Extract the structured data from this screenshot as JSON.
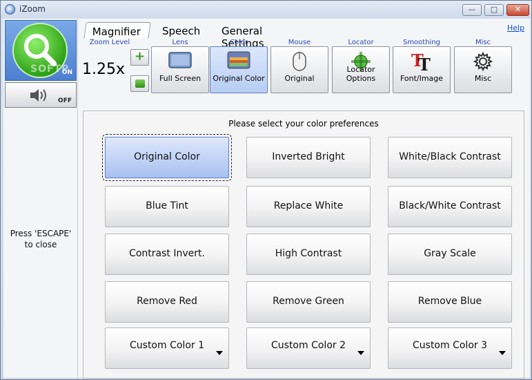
{
  "window": {
    "title": "iZoom",
    "min_glyph": "—",
    "max_glyph": "□",
    "close_glyph": "✕"
  },
  "left_panel": {
    "on_label": "ON",
    "watermark": "SOFTP",
    "off_label": "OFF",
    "escape_text": "Press 'ESCAPE' to close"
  },
  "tabs": [
    {
      "label": "Magnifier"
    },
    {
      "label": "Speech"
    },
    {
      "label": "General Settings"
    }
  ],
  "help_label": "Help",
  "toolbar": {
    "zoom_level_label": "Zoom Level",
    "zoom_value": "1.25x",
    "plus_glyph": "+",
    "groups": [
      {
        "label": "Lens",
        "caption": "Full Screen"
      },
      {
        "label": "Color",
        "caption": "Original Color"
      },
      {
        "label": "Mouse",
        "caption": "Original"
      },
      {
        "label": "Locator",
        "caption": "Locator Options"
      },
      {
        "label": "Smoothing",
        "caption": "Font/Image"
      },
      {
        "label": "Misc",
        "caption": "Misc"
      }
    ]
  },
  "colors": {
    "accent": "#2b47b8",
    "selected_start": "#dfe8fb",
    "selected_end": "#a8c0f2"
  },
  "color_panel": {
    "title": "Please select your color preferences",
    "options": [
      [
        "Original Color",
        "Inverted Bright",
        "White/Black Contrast"
      ],
      [
        "Blue Tint",
        "Replace White",
        "Black/White Contrast"
      ],
      [
        "Contrast Invert.",
        "High Contrast",
        "Gray Scale"
      ],
      [
        "Remove Red",
        "Remove Green",
        "Remove Blue"
      ],
      [
        "Custom Color 1",
        "Custom Color 2",
        "Custom Color 3"
      ]
    ],
    "selected": "Original Color"
  }
}
